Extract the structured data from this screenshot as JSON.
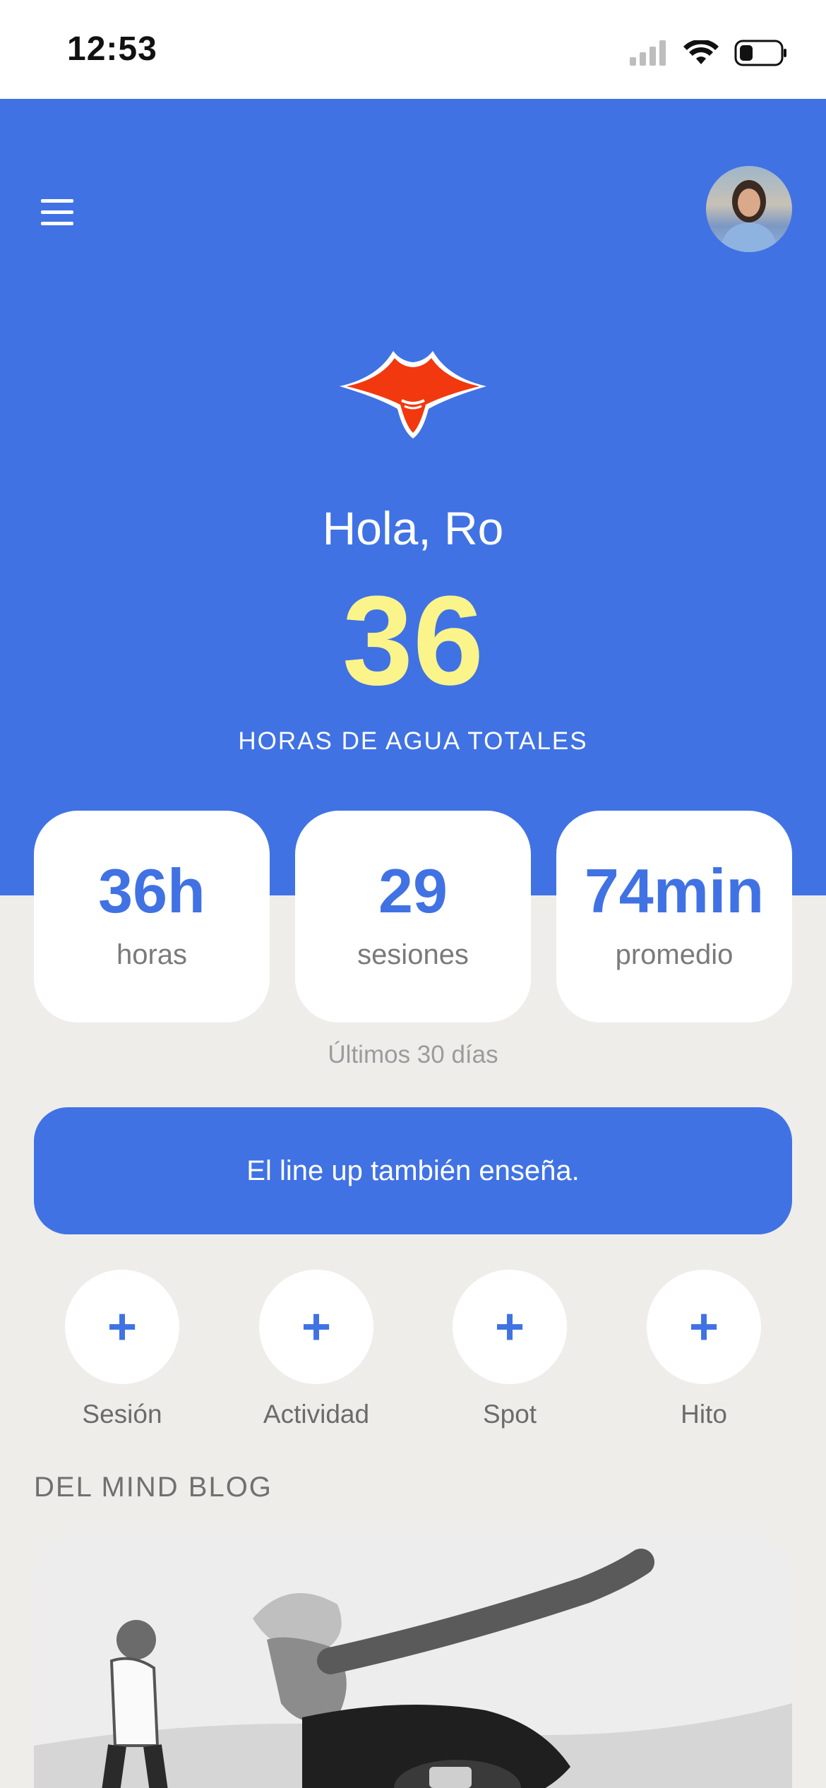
{
  "status_bar": {
    "time": "12:53"
  },
  "header": {
    "menu_icon": "hamburger-icon",
    "avatar": "user-avatar"
  },
  "hero": {
    "logo_icon": "manta-ray-logo",
    "greeting": "Hola, Ro",
    "total_hours": "36",
    "total_hours_label": "HORAS DE AGUA TOTALES"
  },
  "stats": [
    {
      "value": "36h",
      "label": "horas"
    },
    {
      "value": "29",
      "label": "sesiones"
    },
    {
      "value": "74min",
      "label": "promedio"
    }
  ],
  "stats_period": "Últimos 30 días",
  "quote": "El line up también enseña.",
  "quick_actions": [
    {
      "icon": "plus-icon",
      "symbol": "+",
      "label": "Sesión"
    },
    {
      "icon": "plus-icon",
      "symbol": "+",
      "label": "Actividad"
    },
    {
      "icon": "plus-icon",
      "symbol": "+",
      "label": "Spot"
    },
    {
      "icon": "plus-icon",
      "symbol": "+",
      "label": "Hito"
    }
  ],
  "blog": {
    "section_title": "DEL MIND BLOG"
  },
  "colors": {
    "primary": "#4072E4",
    "accent": "#FAF48A",
    "logo": "#F2380F",
    "background": "#EEEDE9"
  }
}
